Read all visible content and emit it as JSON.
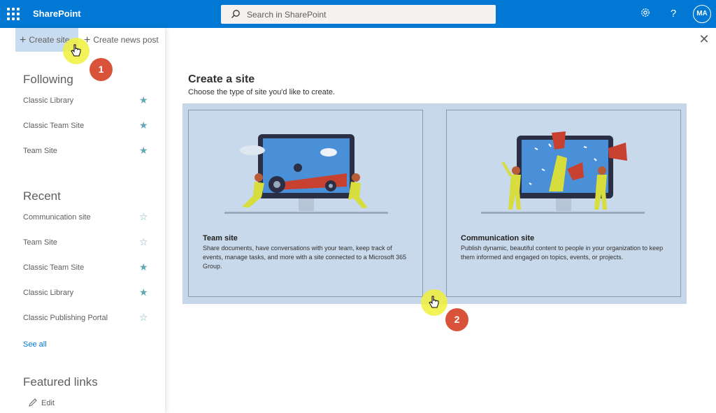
{
  "topbar": {
    "brand": "SharePoint",
    "search_placeholder": "Search in SharePoint",
    "avatar_initials": "MA",
    "color": "#0078d4",
    "icons": [
      "waffle-icon",
      "search-icon",
      "gear-icon",
      "help-icon"
    ]
  },
  "commandbar": {
    "create_site": "Create site",
    "create_news": "Create news post"
  },
  "following": {
    "heading": "Following",
    "items": [
      {
        "label": "Classic Library",
        "starred": true
      },
      {
        "label": "Classic Team Site",
        "starred": true
      },
      {
        "label": "Team Site",
        "starred": true
      }
    ]
  },
  "recent": {
    "heading": "Recent",
    "items": [
      {
        "label": "Communication site",
        "starred": false
      },
      {
        "label": "Team Site",
        "starred": false
      },
      {
        "label": "Classic Team Site",
        "starred": true
      },
      {
        "label": "Classic Library",
        "starred": true
      },
      {
        "label": "Classic Publishing Portal",
        "starred": false
      }
    ],
    "see_all": "See all"
  },
  "featured": {
    "heading": "Featured links",
    "edit": "Edit"
  },
  "dialog": {
    "title": "Create a site",
    "subtitle": "Choose the type of site you'd like to create.",
    "cards": [
      {
        "title": "Team site",
        "description": "Share documents, have conversations with your team, keep track of events, manage tasks, and more with a site connected to a Microsoft 365 Group."
      },
      {
        "title": "Communication site",
        "description": "Publish dynamic, beautiful content to people in your organization to keep them informed and engaged on topics, events, or projects."
      }
    ]
  },
  "annotations": {
    "step1": "1",
    "step2": "2"
  }
}
